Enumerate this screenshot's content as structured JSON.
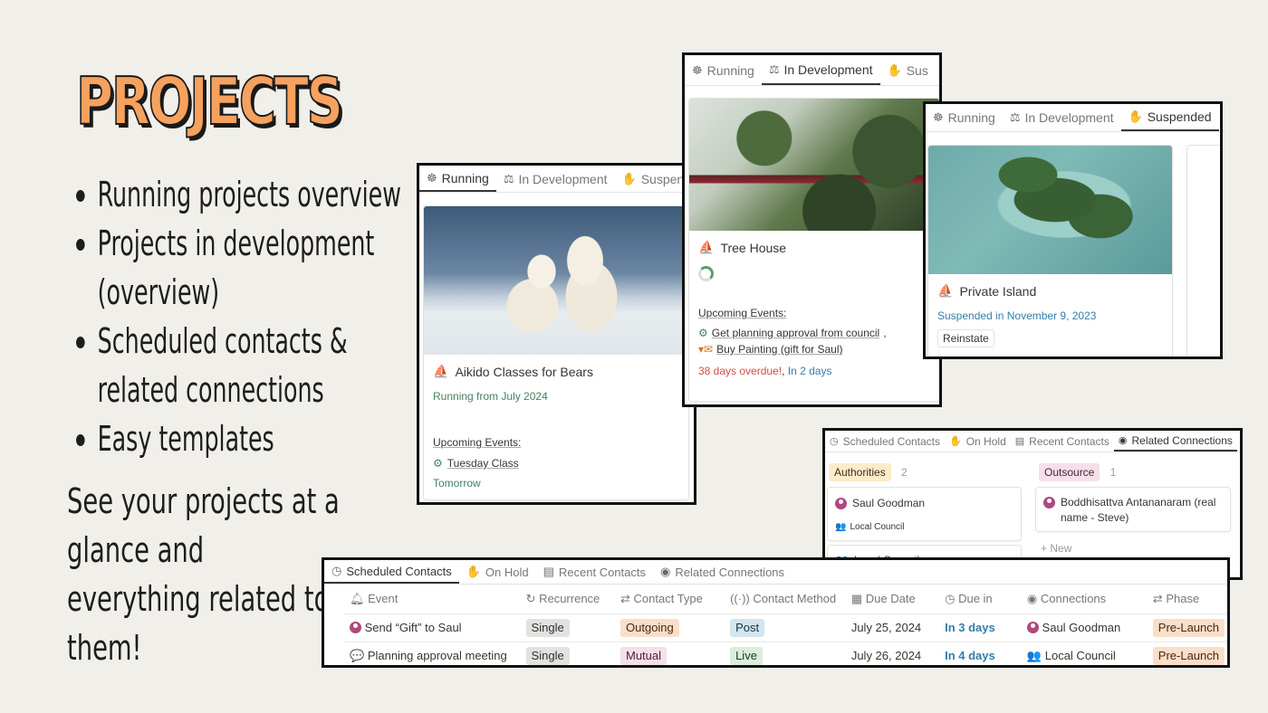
{
  "left": {
    "title": "PROJECTS",
    "bullets": [
      "Running projects overview",
      "Projects in development (overview)",
      "Scheduled contacts & related connections",
      "Easy templates"
    ],
    "tagline": "See your projects at a glance and everything related to them!"
  },
  "running_view": {
    "tabs": [
      "Running",
      "In Development",
      "Suspend"
    ],
    "card": {
      "name": "Aikido Classes for Bears",
      "status": "Running from July 2024",
      "upcoming_label": "Upcoming Events:",
      "event": "Tuesday Class",
      "when": "Tomorrow"
    }
  },
  "dev_view": {
    "tabs": [
      "Running",
      "In Development",
      "Sus"
    ],
    "card": {
      "name": "Tree House",
      "upcoming_label": "Upcoming Events:",
      "events": [
        "Get planning approval from council",
        "Buy Painting (gift for Saul)"
      ],
      "events_sep": ",",
      "overdue": "38 days overdue!",
      "overdue_sep": ",",
      "soon": "In 2 days"
    }
  },
  "suspended_view": {
    "tabs": [
      "Running",
      "In Development",
      "Suspended"
    ],
    "card": {
      "name": "Private Island",
      "status": "Suspended in November 9, 2023",
      "button": "Reinstate"
    }
  },
  "connections_view": {
    "tabs": [
      "Scheduled Contacts",
      "On Hold",
      "Recent Contacts",
      "Related Connections"
    ],
    "groups": [
      {
        "label": "Authorities",
        "count": "2",
        "cards": [
          {
            "name": "Saul Goodman",
            "relation": "Local Council"
          },
          {
            "name": "Local Council"
          }
        ]
      },
      {
        "label": "Outsource",
        "count": "1",
        "cards": [
          {
            "name": "Boddhisattva Antananaram (real name - Steve)"
          }
        ],
        "new_label": "New"
      }
    ]
  },
  "contacts_view": {
    "tabs": [
      "Scheduled Contacts",
      "On Hold",
      "Recent Contacts",
      "Related Connections"
    ],
    "columns": [
      "Event",
      "Recurrence",
      "Contact Type",
      "Contact Method",
      "Due Date",
      "Due in",
      "Connections",
      "Phase"
    ],
    "rows": [
      {
        "event": "Send “Gift” to Saul",
        "recurrence": "Single",
        "type": "Outgoing",
        "method": "Post",
        "due_date": "July 25, 2024",
        "due_in": "In 3 days",
        "connection": "Saul Goodman",
        "phase": "Pre-Launch"
      },
      {
        "event": "Planning approval meeting",
        "recurrence": "Single",
        "type": "Mutual",
        "method": "Live",
        "due_date": "July 26, 2024",
        "due_in": "In 4 days",
        "connection": "Local Council",
        "phase": "Pre-Launch"
      }
    ]
  }
}
